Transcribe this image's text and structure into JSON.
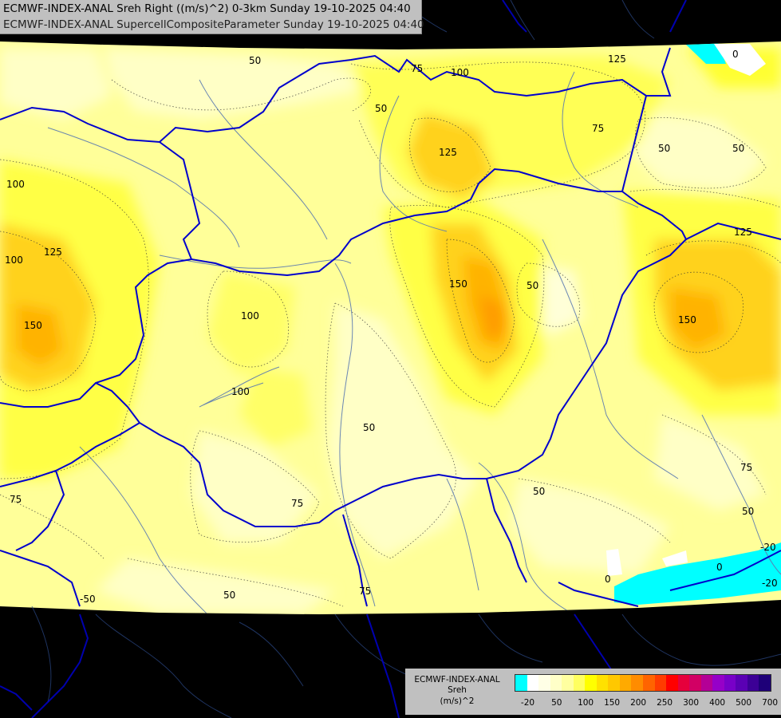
{
  "header": {
    "line1": "ECMWF-INDEX-ANAL Sreh Right ((m/s)^2) 0-3km Sunday 19-10-2025 04:40",
    "line2": "ECMWF-INDEX-ANAL SupercellCompositeParameter Sunday 19-10-2025 04:40"
  },
  "legend": {
    "line1": "ECMWF-INDEX-ANAL",
    "line2": "Sreh",
    "line3": "(m/s)^2",
    "swatch_colors": [
      "#00ffff",
      "#ffffff",
      "#ffffe6",
      "#ffffc8",
      "#ffffa0",
      "#ffff60",
      "#ffff00",
      "#ffe100",
      "#ffc800",
      "#ffaa00",
      "#ff8c00",
      "#ff6400",
      "#ff3c00",
      "#ff0000",
      "#e6003c",
      "#d20064",
      "#b40096",
      "#9600c8",
      "#7800c8",
      "#5a00b4",
      "#3c0096",
      "#1e0078"
    ],
    "ticks": [
      "-20",
      "50",
      "100",
      "150",
      "200",
      "250",
      "300",
      "400",
      "500",
      "700"
    ]
  },
  "colors": {
    "background": "#000000",
    "border": "#0000cc",
    "rivers": "#4a6fa5",
    "base_field": "#ffffaa"
  },
  "contour_labels": [
    "50",
    "75",
    "100",
    "125",
    "150",
    "0",
    "-20",
    "75",
    "125",
    "50",
    "100",
    "125",
    "150",
    "100",
    "-50"
  ]
}
